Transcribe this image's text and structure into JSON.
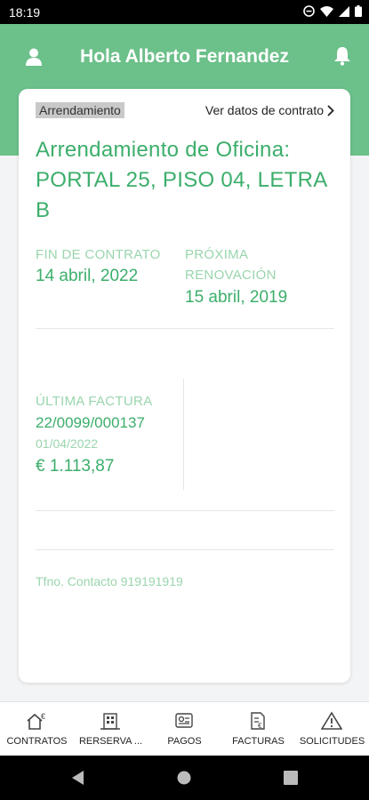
{
  "status_bar": {
    "time": "18:19"
  },
  "header": {
    "greeting": "Hola Alberto Fernandez"
  },
  "contract": {
    "type_tag": "Arrendamiento",
    "details_link": "Ver datos de contrato",
    "title": "Arrendamiento de Oficina: PORTAL 25, PISO 04, LETRA B",
    "end_label": "FIN DE CONTRATO",
    "end_date": "14 abril, 2022",
    "renewal_label_1": "PRÓXIMA",
    "renewal_label_2": "RENOVACIÓN",
    "renewal_date": "15 abril, 2019",
    "last_invoice_label": "ÚLTIMA FACTURA",
    "invoice_number": "22/0099/000137",
    "invoice_date": "01/04/2022",
    "invoice_amount": "€ 1.113,87",
    "contact_phone": "Tfno. Contacto 919191919"
  },
  "bottom_nav": {
    "items": [
      {
        "label": "CONTRATOS",
        "icon": "house-euro-icon"
      },
      {
        "label": "RERSERVA ...",
        "icon": "building-icon"
      },
      {
        "label": "PAGOS",
        "icon": "payment-icon"
      },
      {
        "label": "FACTURAS",
        "icon": "invoice-icon"
      },
      {
        "label": "SOLICITUDES",
        "icon": "warning-icon"
      }
    ]
  },
  "colors": {
    "primary": "#6cc08a",
    "accent_text": "#3cae6b",
    "light_text": "#9ad5ad"
  }
}
